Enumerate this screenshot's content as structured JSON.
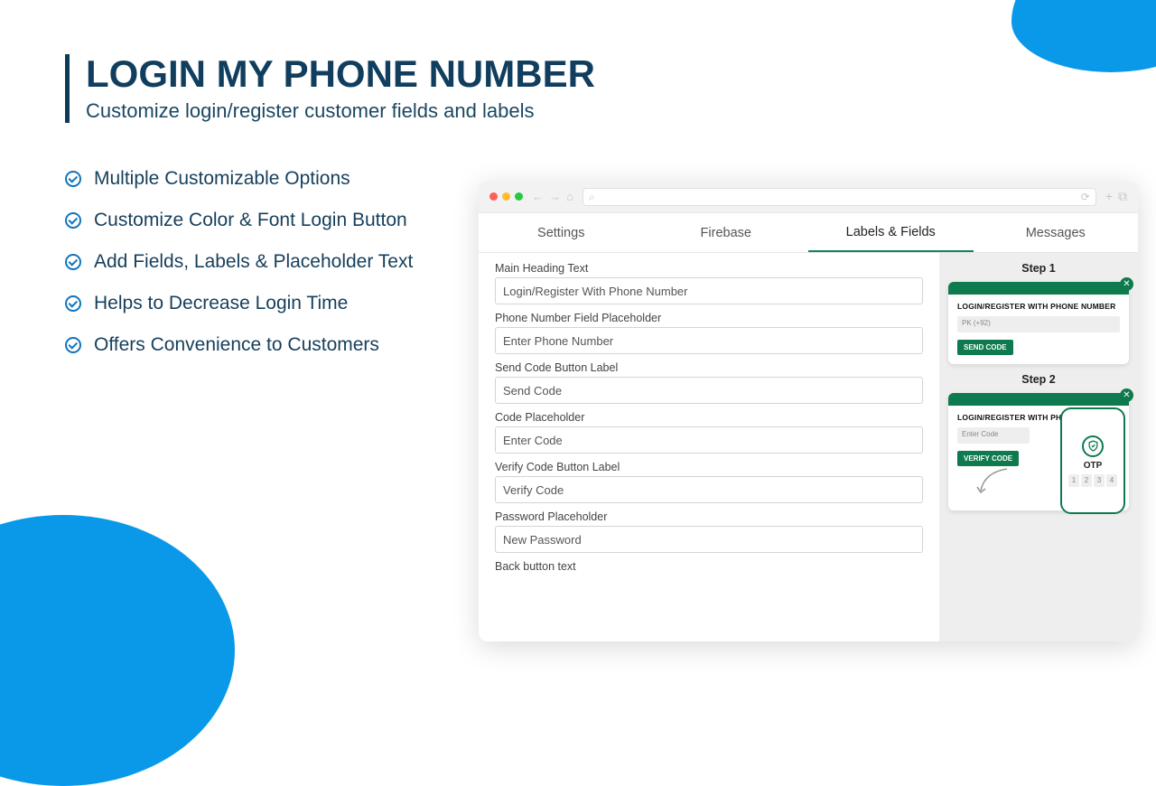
{
  "header": {
    "title": "LOGIN MY PHONE NUMBER",
    "subtitle": "Customize login/register customer fields and labels"
  },
  "features": [
    "Multiple Customizable Options",
    "Customize Color & Font Login Button",
    "Add Fields, Labels & Placeholder Text",
    "Helps to Decrease Login Time",
    "Offers Convenience to Customers"
  ],
  "tabs": [
    "Settings",
    "Firebase",
    "Labels & Fields",
    "Messages"
  ],
  "active_tab_index": 2,
  "form": [
    {
      "label": "Main Heading Text",
      "value": "Login/Register With Phone Number"
    },
    {
      "label": "Phone Number Field Placeholder",
      "value": "Enter Phone Number"
    },
    {
      "label": "Send Code Button Label",
      "value": "Send Code"
    },
    {
      "label": "Code Placeholder",
      "value": "Enter Code"
    },
    {
      "label": "Verify Code Button Label",
      "value": "Verify Code"
    },
    {
      "label": "Password Placeholder",
      "value": "New Password"
    }
  ],
  "form_last_label": "Back button text",
  "preview": {
    "step1_label": "Step 1",
    "step2_label": "Step 2",
    "card_heading": "LOGIN/REGISTER WITH PHONE NUMBER",
    "step1_input": "PK (+92)",
    "step1_button": "SEND CODE",
    "step2_input": "Enter Code",
    "step2_button": "VERIFY CODE",
    "otp_label": "OTP",
    "otp_digits": [
      "1",
      "2",
      "3",
      "4"
    ]
  }
}
